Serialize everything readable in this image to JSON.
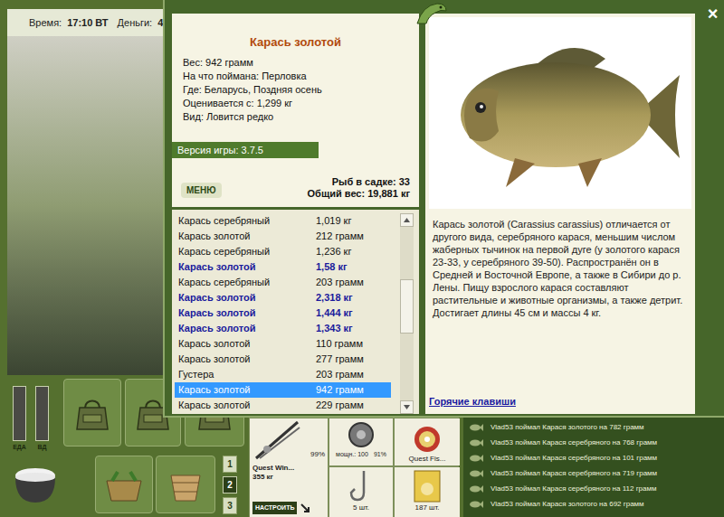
{
  "top_bar": {
    "time_label": "Время:",
    "time": "17:10 ВТ",
    "money_label": "Деньги:",
    "money": "4"
  },
  "dialog": {
    "close": "×",
    "fish_card": {
      "title": "Карась золотой",
      "lines": [
        "Вес: 942 грамм",
        "На что поймана: Перловка",
        "Где: Беларусь, Поздняя осень",
        "Оценивается с: 1,299 кг",
        "Вид: Ловится редко"
      ]
    },
    "version": "Версия игры: 3.7.5",
    "menu_button": "МЕНЮ",
    "in_keepnet": "Рыб в садке: 33",
    "total_weight": "Общий вес: 19,881 кг",
    "catch_list": [
      {
        "name": "Карась серебряный",
        "weight": "1,019 кг",
        "trophy": false,
        "selected": false
      },
      {
        "name": "Карась золотой",
        "weight": "212 грамм",
        "trophy": false,
        "selected": false
      },
      {
        "name": "Карась серебряный",
        "weight": "1,236 кг",
        "trophy": false,
        "selected": false
      },
      {
        "name": "Карась золотой",
        "weight": "1,58 кг",
        "trophy": true,
        "selected": false
      },
      {
        "name": "Карась серебряный",
        "weight": "203 грамм",
        "trophy": false,
        "selected": false
      },
      {
        "name": "Карась золотой",
        "weight": "2,318 кг",
        "trophy": true,
        "selected": false
      },
      {
        "name": "Карась золотой",
        "weight": "1,444 кг",
        "trophy": true,
        "selected": false
      },
      {
        "name": "Карась золотой",
        "weight": "1,343 кг",
        "trophy": true,
        "selected": false
      },
      {
        "name": "Карась золотой",
        "weight": "110 грамм",
        "trophy": false,
        "selected": false
      },
      {
        "name": "Карась золотой",
        "weight": "277 грамм",
        "trophy": false,
        "selected": false
      },
      {
        "name": "Густера",
        "weight": "203 грамм",
        "trophy": false,
        "selected": false
      },
      {
        "name": "Карась золотой",
        "weight": "942 грамм",
        "trophy": false,
        "selected": true
      },
      {
        "name": "Карась золотой",
        "weight": "229 грамм",
        "trophy": false,
        "selected": false
      }
    ],
    "scrollbar": {
      "level": 0.3
    },
    "description": "Карась золотой (Carassius carassius) отличается от другого вида, серебряного карася, меньшим числом жаберных тычинок на первой дуге (у золотого карася 23-33, у серебряного 39-50). Распространён он в Средней и Восточной Европе, а также в Сибири до р. Лены. Пищу взрослого карася составляют растительные и животные организмы, а также детрит. Достигает длины 45 см и массы 4 кг.",
    "hotkeys_link": "Горячие клавиши"
  },
  "status": {
    "bars": [
      {
        "label": "ЕДА",
        "level": 1.0
      },
      {
        "label": "ВД",
        "level": 1.0
      }
    ]
  },
  "page_buttons": [
    {
      "label": "1",
      "selected": false
    },
    {
      "label": "2",
      "selected": true
    },
    {
      "label": "3",
      "selected": false
    }
  ],
  "tackle": {
    "rod_name": "Quest Win...",
    "rod_load": "355 кг",
    "rod_wear": "99%",
    "reel_power": "мощн.: 100",
    "reel_wear": "91%",
    "line_name": "Quest Fis...",
    "hooks": "5 шт.",
    "bait": "187 шт.",
    "setup_button": "НАСТРОИТЬ"
  },
  "log": [
    "Vlad53 поймал Карася золотого на 782 грамм",
    "Vlad53 поймал Карася серебряного на 768 грамм",
    "Vlad53 поймал Карася серебряного на 101 грамм",
    "Vlad53 поймал Карася серебряного на 719 грамм",
    "Vlad53 поймал Карася серебряного на 112 грамм",
    "Vlad53 поймал Карася золотого на 692 грамм"
  ]
}
